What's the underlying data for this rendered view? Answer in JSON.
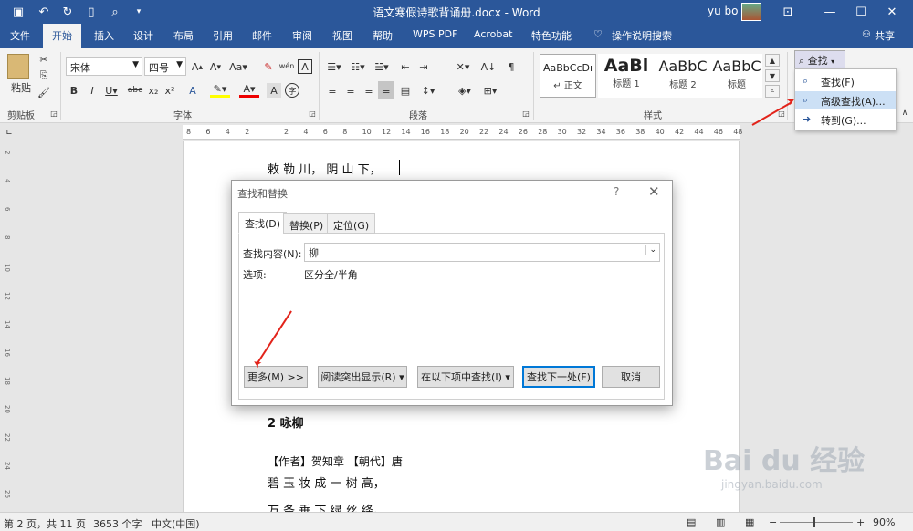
{
  "titlebar": {
    "title": "语文寒假诗歌背诵册.docx - Word",
    "user": "yu bo"
  },
  "tabs": [
    "文件",
    "开始",
    "插入",
    "设计",
    "布局",
    "引用",
    "邮件",
    "审阅",
    "视图",
    "帮助",
    "WPS PDF",
    "Acrobat",
    "特色功能",
    "操作说明搜索"
  ],
  "share": "共享",
  "ribbon": {
    "paste": "粘贴",
    "font_name": "宋体",
    "font_size": "四号",
    "groups": {
      "clipboard": "剪贴板",
      "font": "字体",
      "paragraph": "段落",
      "styles": "样式"
    },
    "styles": [
      {
        "preview": "AaBbCcDı",
        "name": "↵ 正文"
      },
      {
        "preview": "AaBl",
        "name": "标题 1"
      },
      {
        "preview": "AaBbC",
        "name": "标题 2"
      },
      {
        "preview": "AaBbC",
        "name": "标题"
      }
    ],
    "find_label": "查找",
    "find_menu": [
      "查找(F)",
      "高级查找(A)...",
      "转到(G)..."
    ]
  },
  "ruler_marks": [
    "8",
    "6",
    "4",
    "2",
    "",
    "2",
    "4",
    "6",
    "8",
    "10",
    "12",
    "14",
    "16",
    "18",
    "20",
    "22",
    "24",
    "26",
    "28",
    "30",
    "32",
    "34",
    "36",
    "38",
    "40",
    "42",
    "44",
    "46",
    "48"
  ],
  "vruler_marks": [
    "2",
    "4",
    "6",
    "8",
    "10",
    "12",
    "14",
    "16",
    "18",
    "20",
    "22",
    "24",
    "26"
  ],
  "doc": {
    "line1": "敕 勒 川， 阴 山 下，",
    "heading": "2  咏柳",
    "author": "【作者】贺知章 【朝代】唐",
    "line2": "碧 玉 妆 成 一 树 高，",
    "line3": "万 条 垂 下 绿 丝 绦。"
  },
  "dialog": {
    "title": "查找和替换",
    "help": "?",
    "tabs": [
      "查找(D)",
      "替换(P)",
      "定位(G)"
    ],
    "find_label": "查找内容(N):",
    "find_value": "柳",
    "options_label": "选项:",
    "options_value": "区分全/半角",
    "buttons": [
      "更多(M) >>",
      "阅读突出显示(R) ▾",
      "在以下项中查找(I) ▾",
      "查找下一处(F)",
      "取消"
    ]
  },
  "status": {
    "page": "第 2 页，共 11 页",
    "words": "3653 个字",
    "lang": "中文(中国)",
    "zoom": "90%"
  },
  "watermark": {
    "brand": "Bai du 经验",
    "url": "jingyan.baidu.com"
  },
  "colors": {
    "accent": "#2b579a",
    "annotation": "#e2231a"
  }
}
